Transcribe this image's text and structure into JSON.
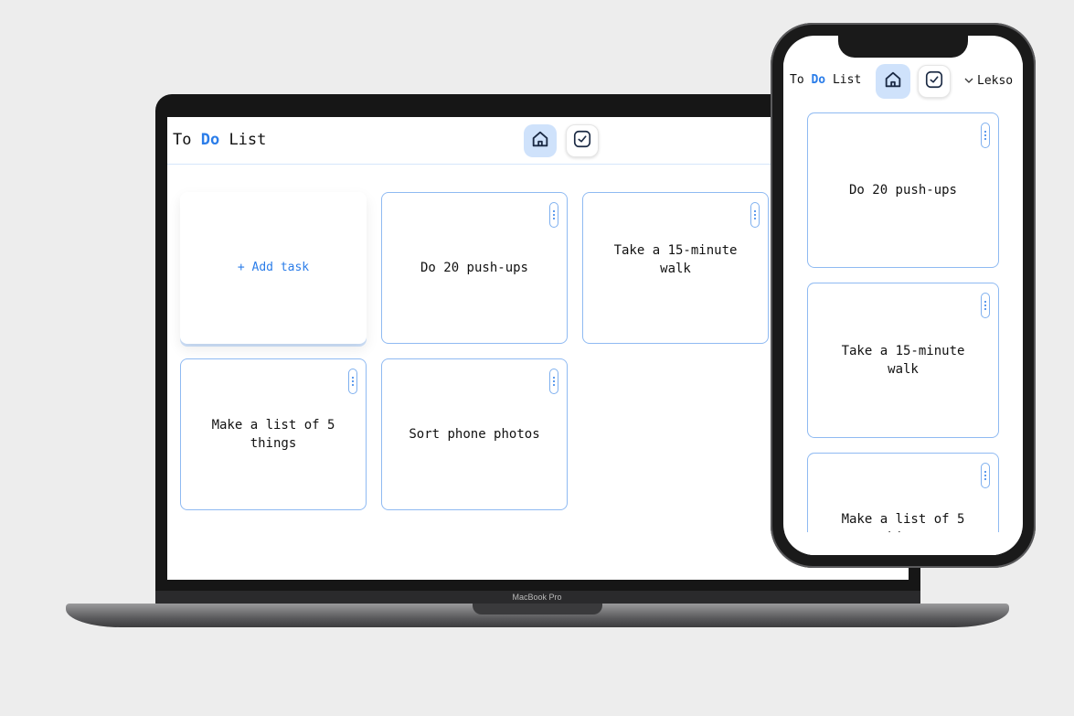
{
  "app": {
    "title_prefix": "To ",
    "title_accent": "Do",
    "title_suffix": " List"
  },
  "nav": {
    "home_icon": "home-icon",
    "tasks_icon": "check-square-icon"
  },
  "user": {
    "chevron_icon": "chevron-down-icon",
    "name": "Lekso"
  },
  "tasks": {
    "add_label": "+ Add task",
    "items": [
      {
        "title": "Do 20 push-ups"
      },
      {
        "title": "Take a 15-minute walk"
      },
      {
        "title": "Make a list of 5 things"
      },
      {
        "title": "Sort phone photos"
      }
    ]
  },
  "device": {
    "laptop_label": "MacBook Pro"
  },
  "colors": {
    "accent": "#2b7de9",
    "card_border": "#8fbaf2",
    "active_nav_bg": "#cfe2fb",
    "background": "#ededed"
  }
}
